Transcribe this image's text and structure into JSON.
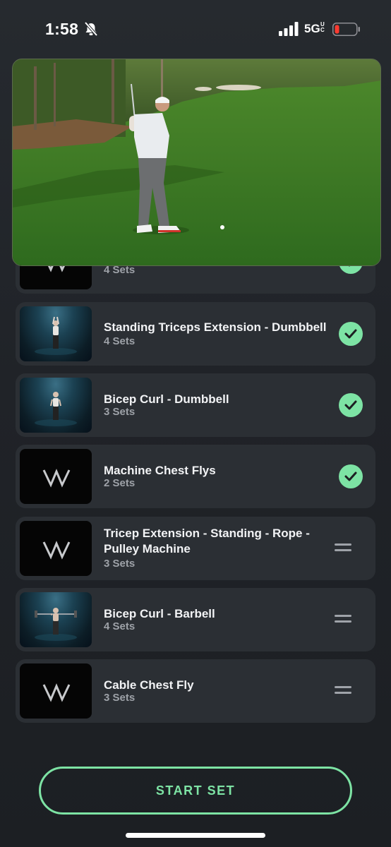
{
  "status_bar": {
    "time": "1:58",
    "network": "5G",
    "network_sub_top": "U",
    "network_sub_bottom": "C",
    "silent_icon": "bell-slash-icon",
    "battery_color": "#ff3b30"
  },
  "video": {
    "description_icon": "golf-video-player"
  },
  "exercises": [
    {
      "name": "",
      "sets": "4 Sets",
      "status": "done",
      "thumb": "logo"
    },
    {
      "name": "Standing Triceps Extension - Dumbbell",
      "sets": "4 Sets",
      "status": "done",
      "thumb": "photo"
    },
    {
      "name": "Bicep Curl - Dumbbell",
      "sets": "3 Sets",
      "status": "done",
      "thumb": "photo"
    },
    {
      "name": "Machine Chest Flys",
      "sets": "2 Sets",
      "status": "done",
      "thumb": "logo"
    },
    {
      "name": "Tricep Extension - Standing - Rope - Pulley Machine",
      "sets": "3 Sets",
      "status": "pending",
      "thumb": "logo"
    },
    {
      "name": "Bicep Curl - Barbell",
      "sets": "4 Sets",
      "status": "pending",
      "thumb": "photo"
    },
    {
      "name": "Cable Chest Fly",
      "sets": "3 Sets",
      "status": "pending",
      "thumb": "logo"
    }
  ],
  "start_button": {
    "label": "START SET"
  },
  "colors": {
    "accent": "#7de3a4",
    "card": "#2b2f34",
    "background": "#202328"
  }
}
